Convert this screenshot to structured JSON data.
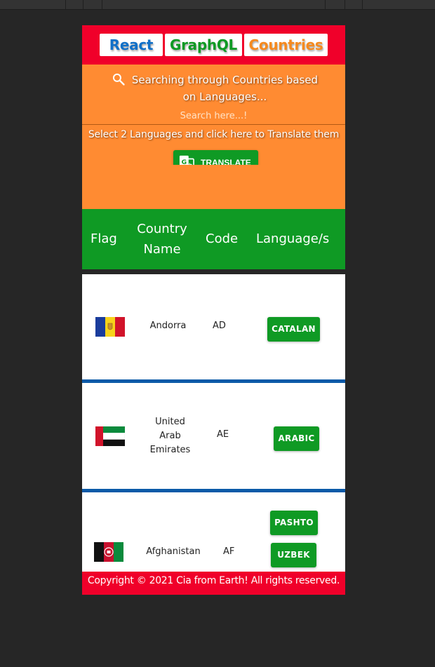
{
  "header": {
    "brand_react": "React",
    "brand_graphql": "GraphQL",
    "brand_countries": "Countries"
  },
  "search": {
    "title": "Searching through Countries based on Languages...",
    "placeholder": "Search here...!",
    "icon": "search-icon"
  },
  "translate": {
    "hint": "Select 2 Languages and click here to Translate them",
    "button_label": "TRANSLATE",
    "icon": "google-translate-icon"
  },
  "table": {
    "headers": {
      "flag": "Flag",
      "country_name_line1": "Country",
      "country_name_line2": "Name",
      "code": "Code",
      "languages": "Language/s"
    },
    "rows": [
      {
        "flag": "🇦🇩",
        "name": "Andorra",
        "code": "AD",
        "languages": [
          "CATALAN"
        ]
      },
      {
        "flag": "🇦🇪",
        "name_lines": [
          "United",
          "Arab",
          "Emirates"
        ],
        "code": "AE",
        "languages": [
          "ARABIC"
        ]
      },
      {
        "flag": "🇦🇫",
        "name": "Afghanistan",
        "code": "AF",
        "languages": [
          "PASHTO",
          "UZBEK"
        ]
      }
    ]
  },
  "footer": {
    "text": "Copyright © 2021  Cia from Earth! All rights reserved."
  },
  "colors": {
    "header_red": "#f0002a",
    "search_orange": "#ff8b32",
    "accent_green": "#0f9a24",
    "row_divider_blue": "#0b5aa8",
    "background": "#262626"
  }
}
